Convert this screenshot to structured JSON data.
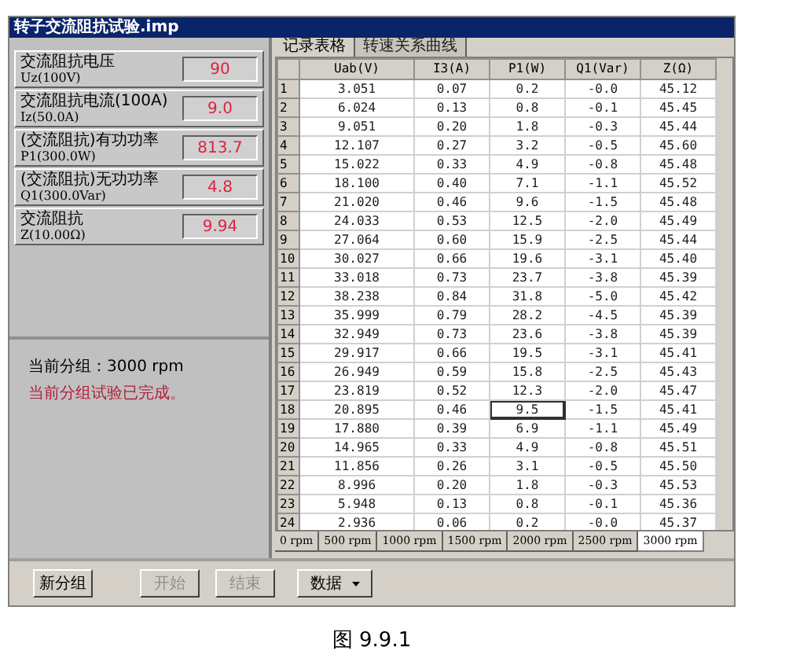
{
  "window": {
    "title": "转子交流阻抗试验.imp"
  },
  "readings": [
    {
      "label": "交流阻抗电压",
      "unit": "Uz(100V)",
      "value": "90"
    },
    {
      "label": "交流阻抗电流(100A)",
      "unit": "Iz(50.0A)",
      "value": "9.0"
    },
    {
      "label": "(交流阻抗)有功功率",
      "unit": "P1(300.0W)",
      "value": "813.7"
    },
    {
      "label": "(交流阻抗)无功功率",
      "unit": "Q1(300.0Var)",
      "value": "4.8"
    },
    {
      "label": "交流阻抗",
      "unit": "Z(10.00Ω)",
      "value": "9.94"
    }
  ],
  "status": {
    "group": "当前分组：3000 rpm",
    "message": "当前分组试验已完成。"
  },
  "tabs": [
    {
      "label": "记录表格",
      "selected": true
    },
    {
      "label": "转速关系曲线",
      "selected": false
    }
  ],
  "table": {
    "columns": [
      "Uab(V)",
      "I3(A)",
      "P1(W)",
      "Q1(Var)",
      "Z(Ω)"
    ],
    "rows": [
      {
        "index": "1",
        "cells": [
          "3.051",
          "0.07",
          "0.2",
          "-0.0",
          "45.12"
        ],
        "selected": false
      },
      {
        "index": "2",
        "cells": [
          "6.024",
          "0.13",
          "0.8",
          "-0.1",
          "45.45"
        ],
        "selected": false
      },
      {
        "index": "3",
        "cells": [
          "9.051",
          "0.20",
          "1.8",
          "-0.3",
          "45.44"
        ],
        "selected": false
      },
      {
        "index": "4",
        "cells": [
          "12.107",
          "0.27",
          "3.2",
          "-0.5",
          "45.60"
        ],
        "selected": false
      },
      {
        "index": "5",
        "cells": [
          "15.022",
          "0.33",
          "4.9",
          "-0.8",
          "45.48"
        ],
        "selected": false
      },
      {
        "index": "6",
        "cells": [
          "18.100",
          "0.40",
          "7.1",
          "-1.1",
          "45.52"
        ],
        "selected": false
      },
      {
        "index": "7",
        "cells": [
          "21.020",
          "0.46",
          "9.6",
          "-1.5",
          "45.48"
        ],
        "selected": false
      },
      {
        "index": "8",
        "cells": [
          "24.033",
          "0.53",
          "12.5",
          "-2.0",
          "45.49"
        ],
        "selected": false
      },
      {
        "index": "9",
        "cells": [
          "27.064",
          "0.60",
          "15.9",
          "-2.5",
          "45.44"
        ],
        "selected": false
      },
      {
        "index": "10",
        "cells": [
          "30.027",
          "0.66",
          "19.6",
          "-3.1",
          "45.40"
        ],
        "selected": false
      },
      {
        "index": "11",
        "cells": [
          "33.018",
          "0.73",
          "23.7",
          "-3.8",
          "45.39"
        ],
        "selected": false
      },
      {
        "index": "12",
        "cells": [
          "38.238",
          "0.84",
          "31.8",
          "-5.0",
          "45.42"
        ],
        "selected": false
      },
      {
        "index": "13",
        "cells": [
          "35.999",
          "0.79",
          "28.2",
          "-4.5",
          "45.39"
        ],
        "selected": false
      },
      {
        "index": "14",
        "cells": [
          "32.949",
          "0.73",
          "23.6",
          "-3.8",
          "45.39"
        ],
        "selected": false
      },
      {
        "index": "15",
        "cells": [
          "29.917",
          "0.66",
          "19.5",
          "-3.1",
          "45.41"
        ],
        "selected": false
      },
      {
        "index": "16",
        "cells": [
          "26.949",
          "0.59",
          "15.8",
          "-2.5",
          "45.43"
        ],
        "selected": false
      },
      {
        "index": "17",
        "cells": [
          "23.819",
          "0.52",
          "12.3",
          "-2.0",
          "45.47"
        ],
        "selected": false
      },
      {
        "index": "18",
        "cells": [
          "20.895",
          "0.46",
          "9.5",
          "-1.5",
          "45.41"
        ],
        "selected": true
      },
      {
        "index": "19",
        "cells": [
          "17.880",
          "0.39",
          "6.9",
          "-1.1",
          "45.49"
        ],
        "selected": false
      },
      {
        "index": "20",
        "cells": [
          "14.965",
          "0.33",
          "4.9",
          "-0.8",
          "45.51"
        ],
        "selected": false
      },
      {
        "index": "21",
        "cells": [
          "11.856",
          "0.26",
          "3.1",
          "-0.5",
          "45.50"
        ],
        "selected": false
      },
      {
        "index": "22",
        "cells": [
          "8.996",
          "0.20",
          "1.8",
          "-0.3",
          "45.53"
        ],
        "selected": false
      },
      {
        "index": "23",
        "cells": [
          "5.948",
          "0.13",
          "0.8",
          "-0.1",
          "45.36"
        ],
        "selected": false
      },
      {
        "index": "24",
        "cells": [
          "2.936",
          "0.06",
          "0.2",
          "-0.0",
          "45.37"
        ],
        "selected": false
      }
    ]
  },
  "speed_tabs": [
    {
      "label": "0 rpm",
      "selected": false
    },
    {
      "label": "500 rpm",
      "selected": false
    },
    {
      "label": "1000 rpm",
      "selected": false
    },
    {
      "label": "1500 rpm",
      "selected": false
    },
    {
      "label": "2000 rpm",
      "selected": false
    },
    {
      "label": "2500 rpm",
      "selected": false
    },
    {
      "label": "3000 rpm",
      "selected": true
    }
  ],
  "buttons": [
    {
      "label": "新分组",
      "disabled": false,
      "kind": "button"
    },
    {
      "label": "开始",
      "disabled": true,
      "kind": "button"
    },
    {
      "label": "结束",
      "disabled": true,
      "kind": "button"
    },
    {
      "label": "数据",
      "disabled": false,
      "kind": "dropdown"
    }
  ],
  "caption": "图 9.9.1"
}
